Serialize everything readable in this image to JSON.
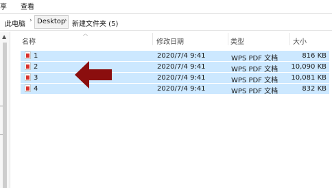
{
  "menu": {
    "share_label": "享",
    "view_label": "查看"
  },
  "breadcrumb": {
    "this_pc": "此电脑",
    "desktop": "Desktop",
    "folder": "新建文件夹 (5)",
    "separator": "›"
  },
  "columns": {
    "name": "名称",
    "date": "修改日期",
    "type": "类型",
    "size": "大小"
  },
  "files": [
    {
      "name": "1",
      "date": "2020/7/4 9:41",
      "type": "WPS PDF 文档",
      "size": "816 KB"
    },
    {
      "name": "2",
      "date": "2020/7/4 9:41",
      "type": "WPS PDF 文档",
      "size": "10,090 KB"
    },
    {
      "name": "3",
      "date": "2020/7/4 9:41",
      "type": "WPS PDF 文档",
      "size": "10,081 KB"
    },
    {
      "name": "4",
      "date": "2020/7/4 9:41",
      "type": "WPS PDF 文档",
      "size": "832 KB"
    }
  ],
  "icons": {
    "file": "pdf-file-icon",
    "annotation": "left-arrow-icon",
    "scroll": "scroll-up-icon",
    "sort": "sort-ascending-icon"
  },
  "colors": {
    "selection": "#cce8ff",
    "arrow": "#8b0e0e",
    "pdf_icon": "#d9302c"
  }
}
